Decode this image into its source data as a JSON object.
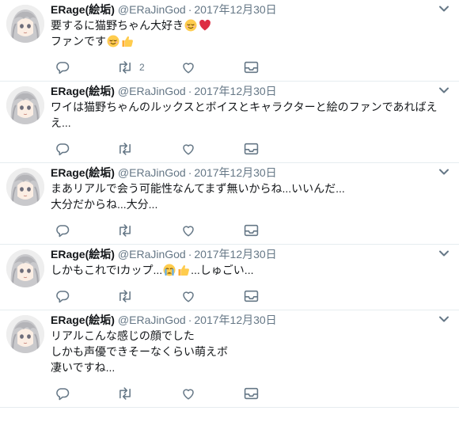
{
  "tweets": [
    {
      "name": "ERage(絵垢)",
      "handle": "@ERaJinGod",
      "separator": "·",
      "date": "2017年12月30日",
      "lines": [
        {
          "text": "要するに猫野ちゃん大好き",
          "emojis": [
            "relieved-face",
            "red-heart"
          ]
        },
        {
          "text": "ファンです",
          "emojis": [
            "relieved-face",
            "thumbs-up"
          ]
        }
      ],
      "retweet_count": "2"
    },
    {
      "name": "ERage(絵垢)",
      "handle": "@ERaJinGod",
      "separator": "·",
      "date": "2017年12月30日",
      "lines": [
        {
          "text": "ワイは猫野ちゃんのルックスとボイスとキャラクターと絵のファンであればえ",
          "emojis": []
        },
        {
          "text": "え...",
          "emojis": []
        }
      ],
      "retweet_count": ""
    },
    {
      "name": "ERage(絵垢)",
      "handle": "@ERaJinGod",
      "separator": "·",
      "date": "2017年12月30日",
      "lines": [
        {
          "text": "まあリアルで会う可能性なんてまず無いからね...いいんだ...",
          "emojis": []
        },
        {
          "text": "大分だからね...大分...",
          "emojis": []
        }
      ],
      "retweet_count": ""
    },
    {
      "name": "ERage(絵垢)",
      "handle": "@ERaJinGod",
      "separator": "·",
      "date": "2017年12月30日",
      "lines": [
        {
          "text": "しかもこれでIカップ...",
          "emojis": [
            "crying-face",
            "thumbs-up"
          ],
          "tail": "...しゅごい..."
        }
      ],
      "retweet_count": ""
    },
    {
      "name": "ERage(絵垢)",
      "handle": "@ERaJinGod",
      "separator": "·",
      "date": "2017年12月30日",
      "lines": [
        {
          "text": "リアルこんな感じの顔でした",
          "emojis": []
        },
        {
          "text": "しかも声優できそーなくらい萌えボ",
          "emojis": []
        },
        {
          "text": "凄いですね...",
          "emojis": []
        }
      ],
      "retweet_count": ""
    }
  ],
  "icons": {
    "reply": "reply-icon",
    "retweet": "retweet-icon",
    "like": "heart-icon",
    "message": "envelope-icon",
    "menu": "chevron-down-icon"
  },
  "colors": {
    "text": "#14171a",
    "secondary": "#657786",
    "divider": "#e6ecf0",
    "heart": "#e0245e"
  }
}
